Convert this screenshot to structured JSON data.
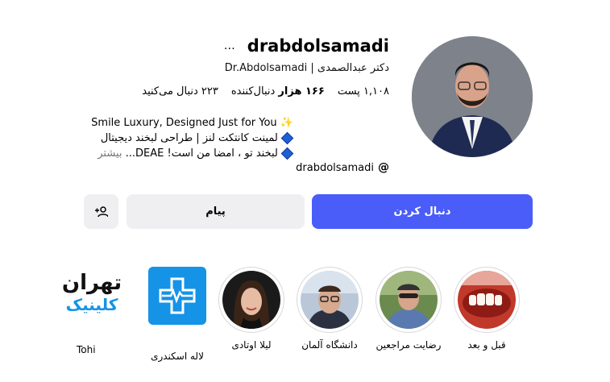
{
  "profile": {
    "username": "drabdolsamadi",
    "more_icon": "…",
    "full_name": "دکتر عبدالصمدی | Dr.Abdolsamadi",
    "stats": {
      "posts_count": "۱,۱۰۸",
      "posts_label": "پست",
      "followers_count": "۱۶۶ هزار",
      "followers_label": "دنبال‌کننده",
      "following_count": "۲۲۳",
      "following_label": "دنبال می‌کنید"
    },
    "bio": {
      "line1": "Smile Luxury, Designed Just for You",
      "line2": "لمینت کانتکت لنز | طراحی لبخند دیجیتال",
      "line3": "لبخند تو ، امضا من است! DEAE...",
      "more": "بیشتر"
    },
    "threads_handle": "drabdolsamadi"
  },
  "actions": {
    "follow_label": "دنبال کردن",
    "message_label": "پیام",
    "suggest_icon": "person-add-icon"
  },
  "highlights": [
    {
      "label": "قبل و بعد"
    },
    {
      "label": "رضایت مراجعین"
    },
    {
      "label": "دانشگاه آلمان"
    },
    {
      "label": "لیلا اوتادی"
    },
    {
      "label": "لاله اسکندری"
    },
    {
      "label": "Tohi"
    }
  ],
  "clinic_logo": {
    "line1": "تهران",
    "line2": "کلینیک"
  },
  "colors": {
    "accent": "#4a5df9",
    "secondary_button": "#efeff2",
    "clinic_blue": "#1593e6"
  }
}
